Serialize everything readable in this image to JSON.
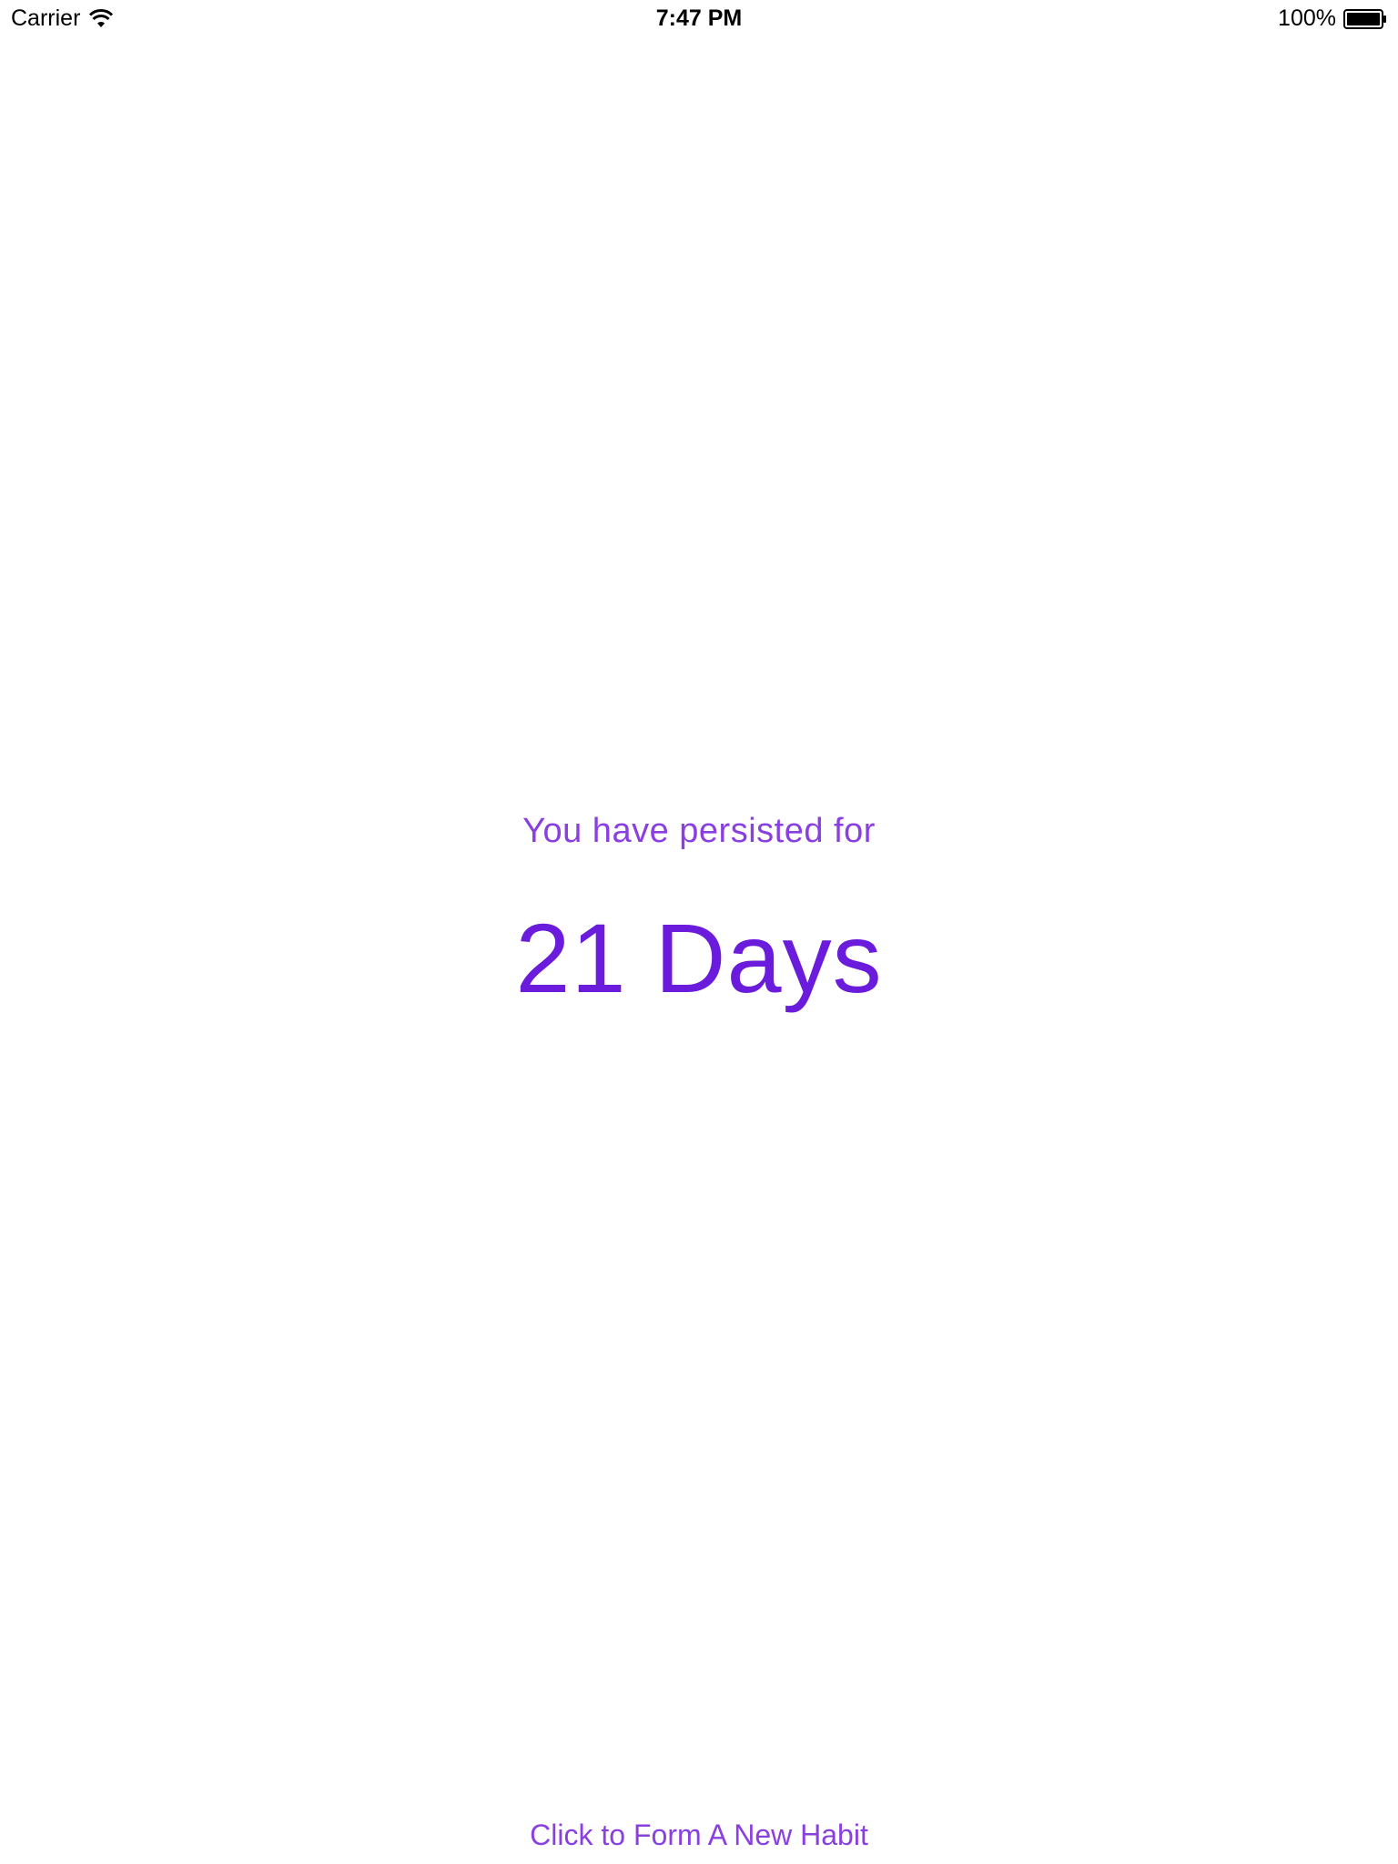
{
  "status_bar": {
    "carrier": "Carrier",
    "wifi_icon": "wifi-icon",
    "time": "7:47 PM",
    "battery_percent": "100%",
    "battery_icon": "battery-full-icon",
    "battery_level": 1.0
  },
  "main": {
    "persist_label": "You have persisted for",
    "days_count": "21 Days",
    "new_habit_button": "Click to Form A New Habit"
  },
  "colors": {
    "accent": "#6a1bdb",
    "accent_light": "#8a3fe0",
    "background": "#ffffff",
    "status_text": "#000000"
  }
}
